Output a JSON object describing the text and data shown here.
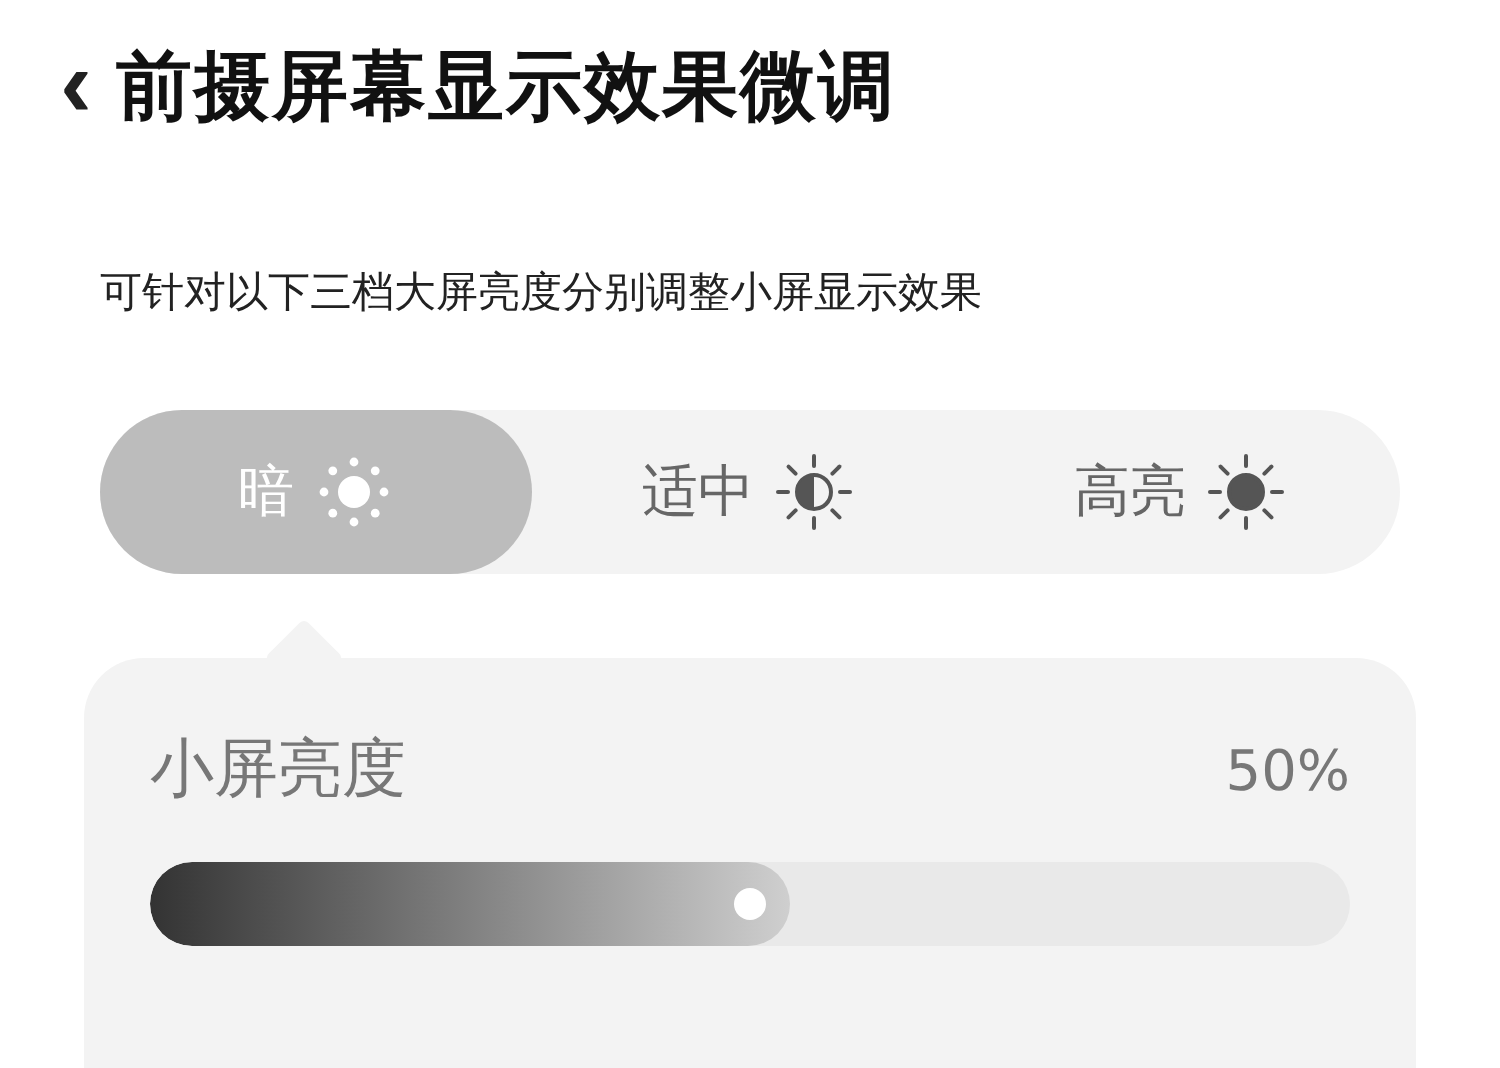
{
  "header": {
    "back": "‹",
    "title": "前摄屏幕显示效果微调"
  },
  "description": "可针对以下三档大屏亮度分别调整小屏显示效果",
  "tabs": [
    {
      "label": "暗",
      "kind": "dim",
      "selected": true
    },
    {
      "label": "适中",
      "kind": "medium",
      "selected": false
    },
    {
      "label": "高亮",
      "kind": "bright",
      "selected": false
    }
  ],
  "panel": {
    "label": "小屏亮度",
    "reading": "50%",
    "level": 0.5
  }
}
